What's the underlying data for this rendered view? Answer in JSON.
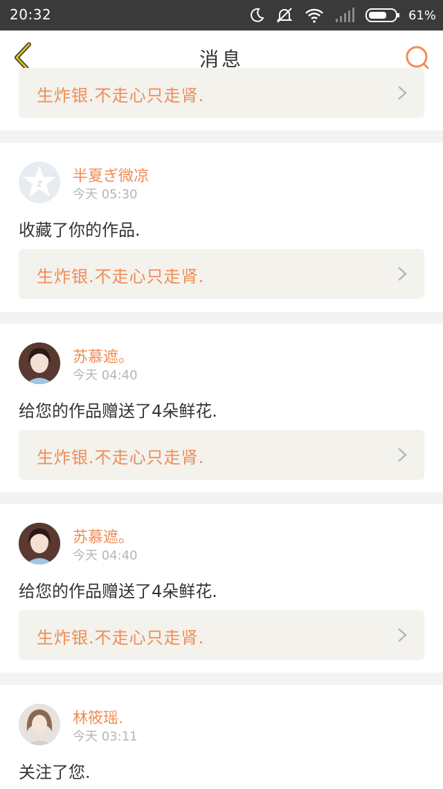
{
  "status_bar": {
    "time": "20:32",
    "battery_percent": "61%",
    "icons": [
      "moon-icon",
      "mute-icon",
      "wifi-icon",
      "signal-icon",
      "battery-icon"
    ]
  },
  "header": {
    "title": "消息",
    "back_icon": "chevron-left-icon",
    "search_icon": "search-icon",
    "accent_color": "#ef8c56",
    "back_color": "#d9c21e"
  },
  "link_label": "生炸银.不走心只走肾.",
  "messages": [
    {
      "username": "半夏ぎ微凉",
      "day": "今天",
      "time": "05:30",
      "action": "收藏了你的作品.",
      "avatar": "default-avatar",
      "link": "生炸银.不走心只走肾."
    },
    {
      "username": "苏慕遮。",
      "day": "今天",
      "time": "04:40",
      "action": "给您的作品赠送了4朵鲜花.",
      "avatar": "user-photo",
      "link": "生炸银.不走心只走肾."
    },
    {
      "username": "苏慕遮。",
      "day": "今天",
      "time": "04:40",
      "action": "给您的作品赠送了4朵鲜花.",
      "avatar": "user-photo",
      "link": "生炸银.不走心只走肾."
    },
    {
      "username": "林筱瑶.",
      "day": "今天",
      "time": "03:11",
      "action": "关注了您.",
      "avatar": "user-photo"
    }
  ]
}
